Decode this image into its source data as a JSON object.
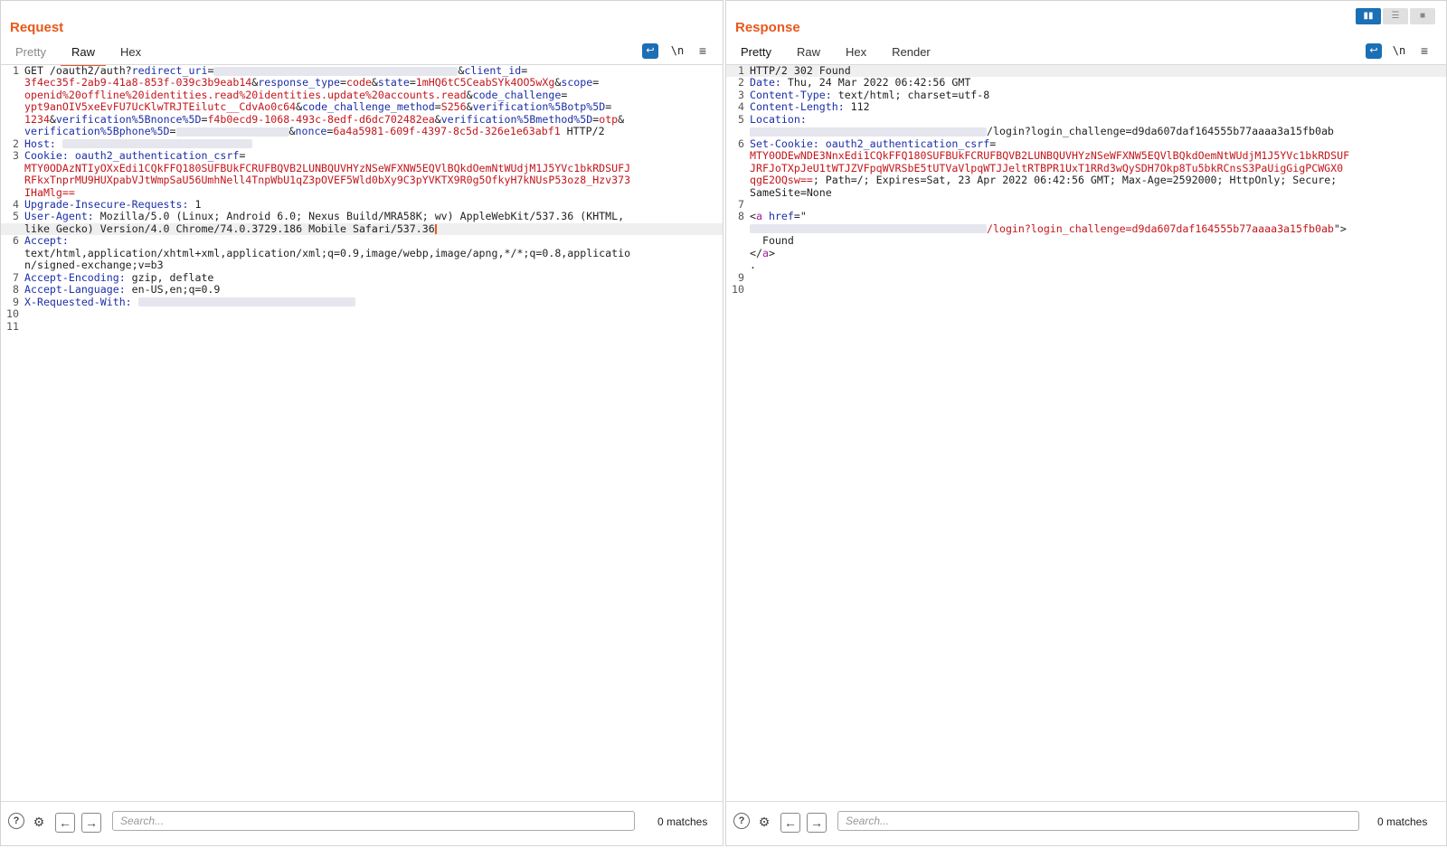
{
  "request": {
    "title": "Request",
    "tabs": [
      "Pretty",
      "Raw",
      "Hex"
    ],
    "active_tab": "Raw",
    "lines": [
      {
        "n": "1",
        "segs": [
          {
            "t": "GET /oauth2/auth?"
          },
          {
            "t": "redirect_uri",
            "c": "k"
          },
          {
            "t": "="
          },
          {
            "b": 270
          },
          {
            "t": "&"
          },
          {
            "t": "client_id",
            "c": "k"
          },
          {
            "t": "="
          }
        ]
      },
      {
        "n": "",
        "segs": [
          {
            "t": "3f4ec35f-2ab9-41a8-853f-039c3b9eab14",
            "c": "v"
          },
          {
            "t": "&"
          },
          {
            "t": "response_type",
            "c": "k"
          },
          {
            "t": "="
          },
          {
            "t": "code",
            "c": "v"
          },
          {
            "t": "&"
          },
          {
            "t": "state",
            "c": "k"
          },
          {
            "t": "="
          },
          {
            "t": "1mHQ6tC5CeabSYk4OO5wXg",
            "c": "v"
          },
          {
            "t": "&"
          },
          {
            "t": "scope",
            "c": "k"
          },
          {
            "t": "="
          }
        ]
      },
      {
        "n": "",
        "segs": [
          {
            "t": "openid%20offline%20identities.read%20identities.update%20accounts.read",
            "c": "v"
          },
          {
            "t": "&"
          },
          {
            "t": "code_challenge",
            "c": "k"
          },
          {
            "t": "="
          }
        ]
      },
      {
        "n": "",
        "segs": [
          {
            "t": "ypt9anOIV5xeEvFU7UcKlwTRJTEilutc__CdvAo0c64",
            "c": "v"
          },
          {
            "t": "&"
          },
          {
            "t": "code_challenge_method",
            "c": "k"
          },
          {
            "t": "="
          },
          {
            "t": "S256",
            "c": "v"
          },
          {
            "t": "&"
          },
          {
            "t": "verification%5Botp%5D",
            "c": "k"
          },
          {
            "t": "="
          }
        ]
      },
      {
        "n": "",
        "segs": [
          {
            "t": "1234",
            "c": "v"
          },
          {
            "t": "&"
          },
          {
            "t": "verification%5Bnonce%5D",
            "c": "k"
          },
          {
            "t": "="
          },
          {
            "t": "f4b0ecd9-1068-493c-8edf-d6dc702482ea",
            "c": "v"
          },
          {
            "t": "&"
          },
          {
            "t": "verification%5Bmethod%5D",
            "c": "k"
          },
          {
            "t": "="
          },
          {
            "t": "otp",
            "c": "v"
          },
          {
            "t": "&"
          }
        ]
      },
      {
        "n": "",
        "segs": [
          {
            "t": "verification%5Bphone%5D",
            "c": "k"
          },
          {
            "t": "="
          },
          {
            "b": 125
          },
          {
            "t": "&"
          },
          {
            "t": "nonce",
            "c": "k"
          },
          {
            "t": "="
          },
          {
            "t": "6a4a5981-609f-4397-8c5d-326e1e63abf1",
            "c": "v"
          },
          {
            "t": " HTTP/2"
          }
        ]
      },
      {
        "n": "2",
        "segs": [
          {
            "t": "Host:",
            "c": "k"
          },
          {
            "t": " "
          },
          {
            "b": 210
          }
        ]
      },
      {
        "n": "3",
        "segs": [
          {
            "t": "Cookie:",
            "c": "k"
          },
          {
            "t": " "
          },
          {
            "t": "oauth2_authentication_csrf",
            "c": "k"
          },
          {
            "t": "="
          }
        ]
      },
      {
        "n": "",
        "segs": [
          {
            "t": "MTY0ODAzNTIyOXxEdi1CQkFFQ180SUFBUkFCRUFBQVB2LUNBQUVHYzNSeWFXNW5EQVlBQkdOemNtWUdjM1J5YVc1bkRDSUFJ",
            "c": "v"
          }
        ]
      },
      {
        "n": "",
        "segs": [
          {
            "t": "RFkxTnprMU9HUXpabVJtWmpSaU56UmhNell4TnpWbU1qZ3pOVEF5Wld0bXy9C3pYVKTX9R0g5OfkyH7kNUsP53oz8_Hzv373",
            "c": "v"
          }
        ]
      },
      {
        "n": "",
        "segs": [
          {
            "t": "IHaMlg==",
            "c": "v"
          }
        ]
      },
      {
        "n": "4",
        "segs": [
          {
            "t": "Upgrade-Insecure-Requests:",
            "c": "k"
          },
          {
            "t": " 1"
          }
        ]
      },
      {
        "n": "5",
        "segs": [
          {
            "t": "User-Agent:",
            "c": "k"
          },
          {
            "t": " Mozilla/5.0 (Linux; Android 6.0; Nexus Build/MRA58K; wv) AppleWebKit/537.36 (KHTML,"
          }
        ]
      },
      {
        "n": "",
        "hl": true,
        "caret": true,
        "segs": [
          {
            "t": "like Gecko) Version/4.0 Chrome/74.0.3729.186 Mobile Safari/537.36"
          }
        ]
      },
      {
        "n": "6",
        "segs": [
          {
            "t": "Accept:",
            "c": "k"
          }
        ]
      },
      {
        "n": "",
        "segs": [
          {
            "t": "text/html,application/xhtml+xml,application/xml;q=0.9,image/webp,image/apng,*/*;q=0.8,applicatio"
          }
        ]
      },
      {
        "n": "",
        "segs": [
          {
            "t": "n/signed-exchange;v=b3"
          }
        ]
      },
      {
        "n": "7",
        "segs": [
          {
            "t": "Accept-Encoding:",
            "c": "k"
          },
          {
            "t": " gzip, deflate"
          }
        ]
      },
      {
        "n": "8",
        "segs": [
          {
            "t": "Accept-Language:",
            "c": "k"
          },
          {
            "t": " en-US,en;q=0.9"
          }
        ]
      },
      {
        "n": "9",
        "segs": [
          {
            "t": "X-Requested-With:",
            "c": "k"
          },
          {
            "t": " "
          },
          {
            "b": 240
          }
        ]
      },
      {
        "n": "10",
        "segs": []
      },
      {
        "n": "11",
        "segs": []
      }
    ],
    "search_placeholder": "Search...",
    "matches": "0 matches"
  },
  "response": {
    "title": "Response",
    "tabs": [
      "Pretty",
      "Raw",
      "Hex",
      "Render"
    ],
    "active_tab": "Pretty",
    "lines": [
      {
        "n": "1",
        "hl": true,
        "segs": [
          {
            "t": "HTTP/2 302 Found"
          }
        ]
      },
      {
        "n": "2",
        "segs": [
          {
            "t": "Date:",
            "c": "k"
          },
          {
            "t": " Thu, 24 Mar 2022 06:42:56 GMT"
          }
        ]
      },
      {
        "n": "3",
        "segs": [
          {
            "t": "Content-Type:",
            "c": "k"
          },
          {
            "t": " text/html; charset=utf-8"
          }
        ]
      },
      {
        "n": "4",
        "segs": [
          {
            "t": "Content-Length:",
            "c": "k"
          },
          {
            "t": " 112"
          }
        ]
      },
      {
        "n": "5",
        "segs": [
          {
            "t": "Location:",
            "c": "k"
          }
        ]
      },
      {
        "n": "",
        "segs": [
          {
            "b": 262
          },
          {
            "t": "/login?login_challenge=d9da607daf164555b77aaaa3a15fb0ab"
          }
        ]
      },
      {
        "n": "6",
        "segs": [
          {
            "t": "Set-Cookie:",
            "c": "k"
          },
          {
            "t": " "
          },
          {
            "t": "oauth2_authentication_csrf",
            "c": "k"
          },
          {
            "t": "="
          }
        ]
      },
      {
        "n": "",
        "segs": [
          {
            "t": "MTY0ODEwNDE3NnxEdi1CQkFFQ180SUFBUkFCRUFBQVB2LUNBQUVHYzNSeWFXNW5EQVlBQkdOemNtWUdjM1J5YVc1bkRDSUF",
            "c": "v"
          }
        ]
      },
      {
        "n": "",
        "segs": [
          {
            "t": "JRFJoTXpJeU1tWTJZVFpqWVRSbE5tUTVaVlpqWTJJeltRTBPR1UxT1RRd3wQySDH7Okp8Tu5bkRCnsS3PaUigGigPCWGX0",
            "c": "v"
          }
        ]
      },
      {
        "n": "",
        "segs": [
          {
            "t": "qgE2OQsw==",
            "c": "v"
          },
          {
            "t": "; Path=/; Expires=Sat, 23 Apr 2022 06:42:56 GMT; Max-Age=2592000; HttpOnly; Secure;"
          }
        ]
      },
      {
        "n": "",
        "segs": [
          {
            "t": "SameSite=None"
          }
        ]
      },
      {
        "n": "7",
        "segs": []
      },
      {
        "n": "8",
        "segs": [
          {
            "t": "<"
          },
          {
            "t": "a",
            "c": "t"
          },
          {
            "t": " "
          },
          {
            "t": "href",
            "c": "k"
          },
          {
            "t": "=\""
          }
        ]
      },
      {
        "n": "",
        "segs": [
          {
            "b": 262
          },
          {
            "t": "/login?login_challenge=d9da607daf164555b77aaaa3a15fb0ab",
            "c": "v"
          },
          {
            "t": "\">"
          }
        ]
      },
      {
        "n": "",
        "segs": [
          {
            "t": "  Found"
          }
        ]
      },
      {
        "n": "",
        "segs": [
          {
            "t": "</"
          },
          {
            "t": "a",
            "c": "t"
          },
          {
            "t": ">"
          }
        ]
      },
      {
        "n": "",
        "segs": [
          {
            "t": "."
          }
        ]
      },
      {
        "n": "9",
        "segs": []
      },
      {
        "n": "10",
        "segs": []
      }
    ],
    "search_placeholder": "Search...",
    "matches": "0 matches"
  },
  "toolbar": {
    "newline_label": "\\n",
    "wrap_icon": "wrap-lines-icon",
    "menu_icon": "hamburger-menu-icon",
    "help_icon": "help-icon",
    "settings_icon": "gear-icon",
    "back_icon": "arrow-left-icon",
    "forward_icon": "arrow-right-icon"
  },
  "colors": {
    "accent": "#e8581c",
    "key": "#1c2fa8",
    "value": "#c4161c",
    "tag": "#a0239f",
    "active_button": "#1b6fb5"
  }
}
